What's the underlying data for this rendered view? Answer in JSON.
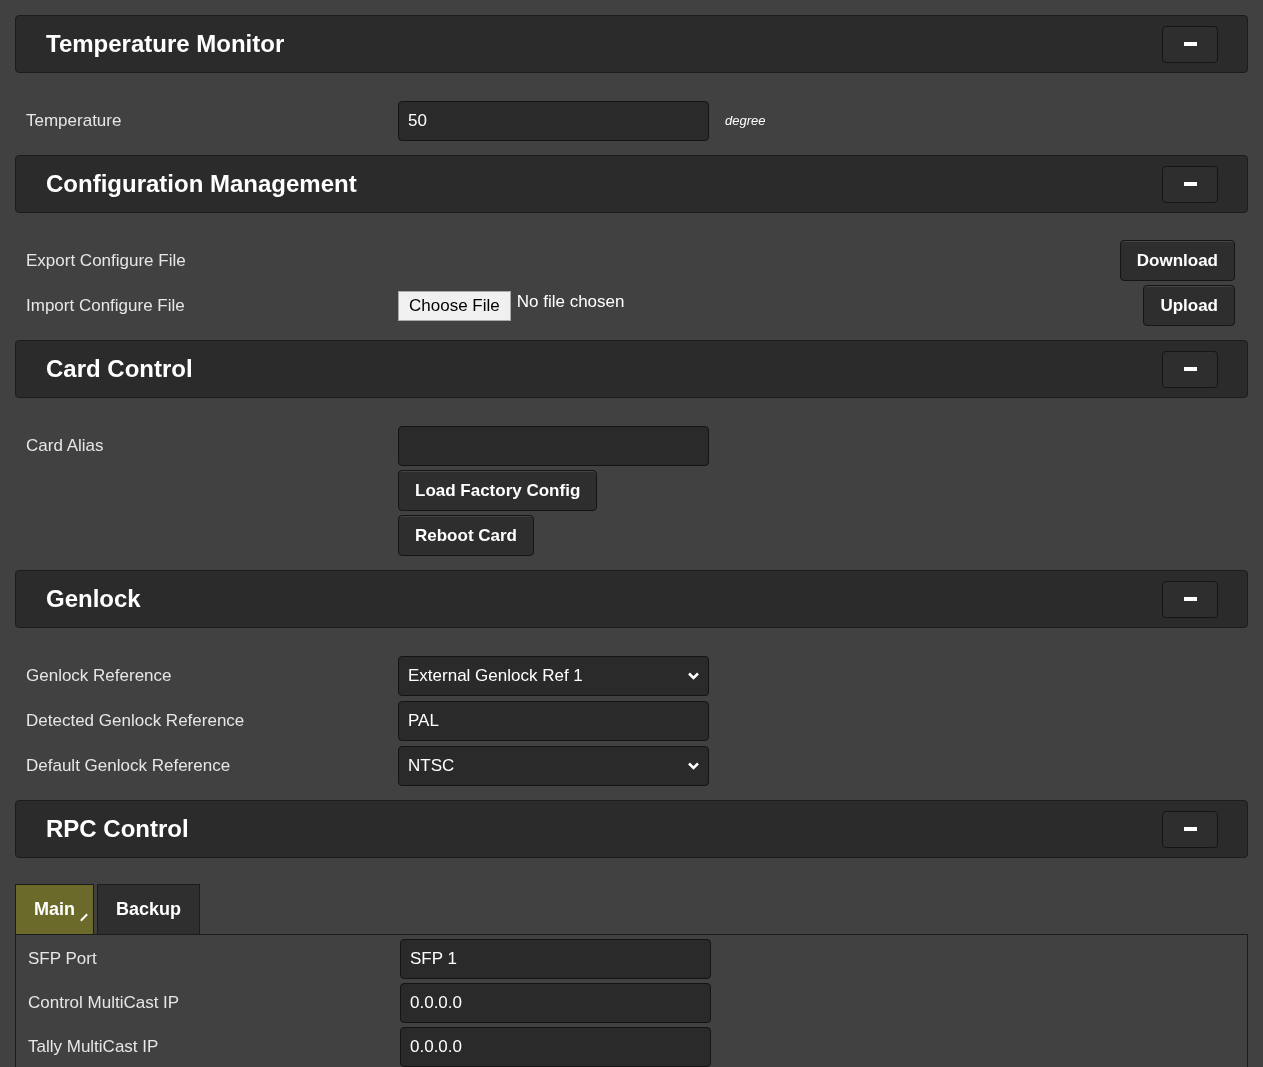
{
  "sections": [
    {
      "title": "Temperature Monitor",
      "rows": [
        {
          "kind": "input",
          "label": "Temperature",
          "value": "50",
          "unit": "degree"
        }
      ]
    },
    {
      "title": "Configuration Management",
      "rows": [
        {
          "kind": "action",
          "label": "Export Configure File",
          "button": "Download"
        },
        {
          "kind": "file",
          "label": "Import Configure File",
          "file_button": "Choose File",
          "file_status": "No file chosen",
          "button": "Upload"
        }
      ]
    },
    {
      "title": "Card Control",
      "rows": [
        {
          "kind": "input",
          "label": "Card Alias"
        },
        {
          "kind": "button",
          "button": "Load Factory Config"
        },
        {
          "kind": "button",
          "button": "Reboot Card"
        }
      ]
    },
    {
      "title": "Genlock",
      "rows": [
        {
          "kind": "select",
          "label": "Genlock Reference",
          "value": "External Genlock Ref 1"
        },
        {
          "kind": "input",
          "label": "Detected Genlock Reference",
          "value": "PAL"
        },
        {
          "kind": "select",
          "label": "Default Genlock Reference",
          "value": "NTSC"
        }
      ]
    },
    {
      "title": "RPC Control",
      "tabs": [
        {
          "label": "Main",
          "selected": true
        },
        {
          "label": "Backup",
          "selected": false
        }
      ],
      "rows": [
        {
          "kind": "input",
          "label": "SFP Port",
          "value": "SFP 1"
        },
        {
          "kind": "input",
          "label": "Control MultiCast IP",
          "value": "0.0.0.0"
        },
        {
          "kind": "input",
          "label": "Tally MultiCast IP",
          "value": "0.0.0.0"
        }
      ]
    }
  ]
}
